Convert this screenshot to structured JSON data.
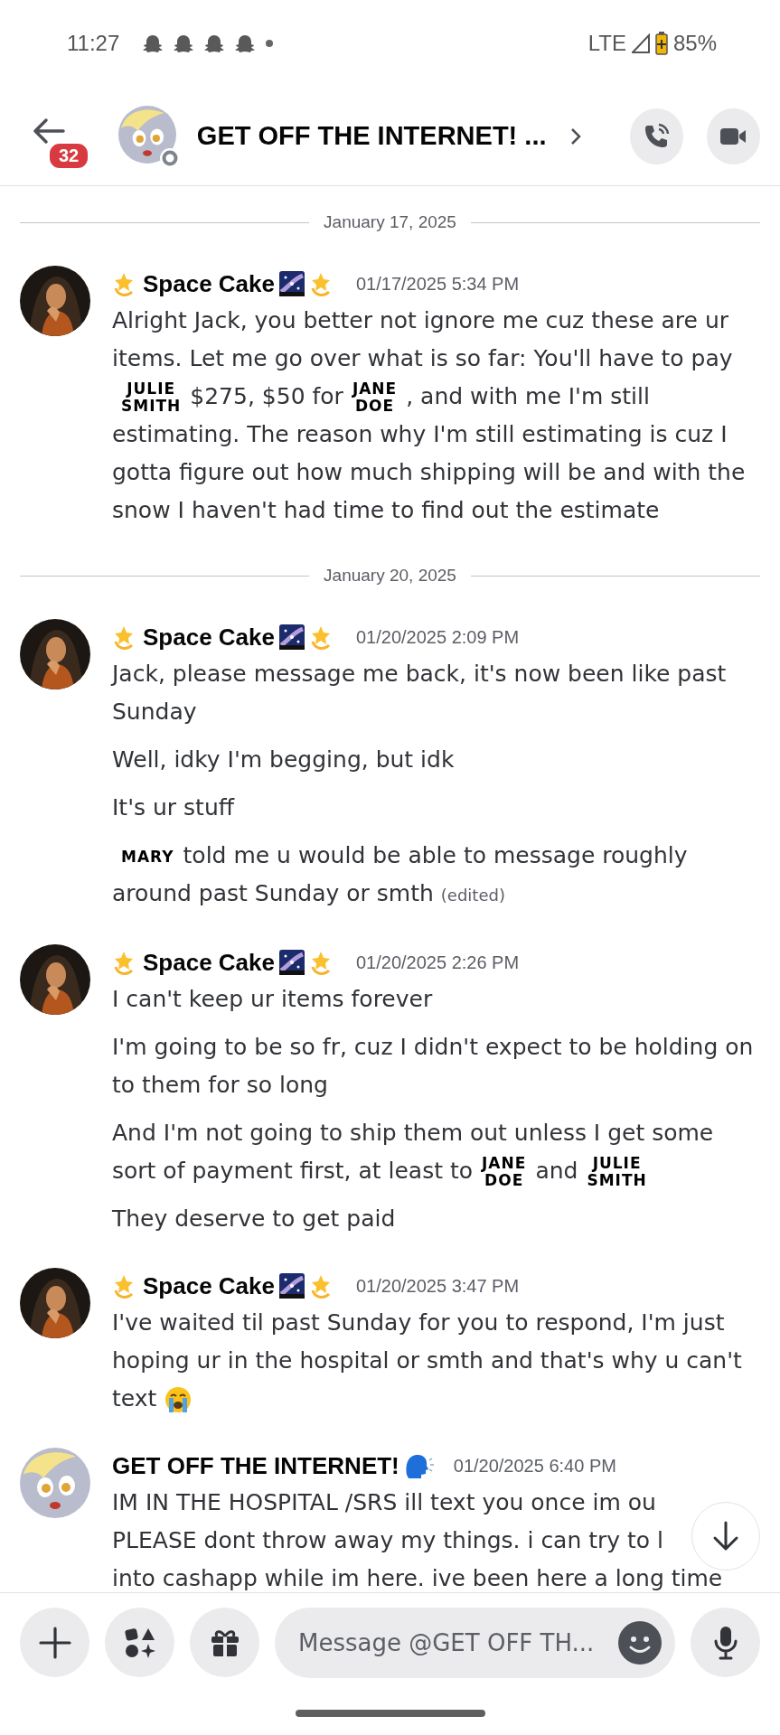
{
  "status_bar": {
    "time": "11:27",
    "network": "LTE",
    "battery": "85%"
  },
  "header": {
    "unread_badge": "32",
    "title": "GET OFF THE INTERNET! ..."
  },
  "feed": [
    {
      "kind": "date",
      "label": "January 17, 2025"
    },
    {
      "kind": "message",
      "author": {
        "kind": "space",
        "name": "Space Cake"
      },
      "timestamp": "01/17/2025 5:34 PM",
      "paragraphs": [
        {
          "kind": "wrap",
          "segments": [
            {
              "kind": "text",
              "text": "Alright Jack, you better not ignore me cuz these are ur items. Let me go over what is so far: You'll have to pay"
            },
            {
              "kind": "tag",
              "lines": [
                "JULIE",
                "SMITH"
              ]
            },
            {
              "kind": "text",
              "text": "$275, $50 for"
            },
            {
              "kind": "tag",
              "lines": [
                "JANE",
                "DOE"
              ]
            },
            {
              "kind": "text",
              "text": ", and with me I'm still estimating. The reason why I'm still estimating is cuz I gotta figure out how much shipping will be and with the snow I haven't had time to find out the estimate"
            }
          ]
        }
      ]
    },
    {
      "kind": "date",
      "label": "January 20, 2025"
    },
    {
      "kind": "message",
      "author": {
        "kind": "space",
        "name": "Space Cake"
      },
      "timestamp": "01/20/2025 2:09 PM",
      "paragraphs": [
        {
          "kind": "wrap",
          "segments": [
            {
              "kind": "text",
              "text": "Jack, please message me back, it's now been like past Sunday"
            }
          ]
        },
        {
          "kind": "wrap",
          "segments": [
            {
              "kind": "text",
              "text": "Well, idky I'm begging, but idk"
            }
          ]
        },
        {
          "kind": "wrap",
          "segments": [
            {
              "kind": "text",
              "text": "It's ur stuff"
            }
          ]
        },
        {
          "kind": "wrap",
          "segments": [
            {
              "kind": "tag",
              "lines": [
                "MARY"
              ]
            },
            {
              "kind": "text",
              "text": "told me u would be able to message roughly around past Sunday or smth"
            },
            {
              "kind": "note",
              "text": "(edited)"
            }
          ]
        }
      ]
    },
    {
      "kind": "message",
      "author": {
        "kind": "space",
        "name": "Space Cake"
      },
      "timestamp": "01/20/2025 2:26 PM",
      "paragraphs": [
        {
          "kind": "wrap",
          "segments": [
            {
              "kind": "text",
              "text": "I can't keep ur items forever"
            }
          ]
        },
        {
          "kind": "wrap",
          "segments": [
            {
              "kind": "text",
              "text": "I'm going to be so fr, cuz I didn't expect to be holding on to them for so long"
            }
          ]
        },
        {
          "kind": "wrap",
          "segments": [
            {
              "kind": "text",
              "text": "And I'm not going to ship them out unless I get some sort of payment first, at least to"
            },
            {
              "kind": "tag",
              "lines": [
                "JANE",
                "DOE"
              ]
            },
            {
              "kind": "text",
              "text": "and"
            },
            {
              "kind": "tag",
              "lines": [
                "JULIE",
                "SMITH"
              ]
            }
          ]
        },
        {
          "kind": "wrap",
          "segments": [
            {
              "kind": "text",
              "text": "They deserve to get paid"
            }
          ]
        }
      ]
    },
    {
      "kind": "message",
      "author": {
        "kind": "space",
        "name": "Space Cake"
      },
      "timestamp": "01/20/2025 3:47 PM",
      "paragraphs": [
        {
          "kind": "wrap",
          "segments": [
            {
              "kind": "text",
              "text": "I've waited til past Sunday for you to respond, I'm just hoping ur in the hospital or smth and that's why u can't text"
            },
            {
              "kind": "crying_emoji"
            }
          ]
        }
      ]
    },
    {
      "kind": "message",
      "author": {
        "kind": "speaker",
        "name": "GET OFF THE INTERNET!"
      },
      "timestamp": "01/20/2025 6:40 PM",
      "paragraphs": [
        {
          "kind": "line",
          "segments": [
            {
              "kind": "text",
              "text": "IM IN THE HOSPITAL /SRS ill text you once im ou"
            }
          ]
        },
        {
          "kind": "line",
          "segments": [
            {
              "kind": "text",
              "text": "PLEASE dont throw away my things. i can try to l"
            }
          ]
        },
        {
          "kind": "line",
          "segments": [
            {
              "kind": "text",
              "text": "into cashapp while im here. ive been here a long time"
            }
          ]
        }
      ]
    }
  ],
  "composer": {
    "placeholder": "Message @GET OFF TH..."
  }
}
